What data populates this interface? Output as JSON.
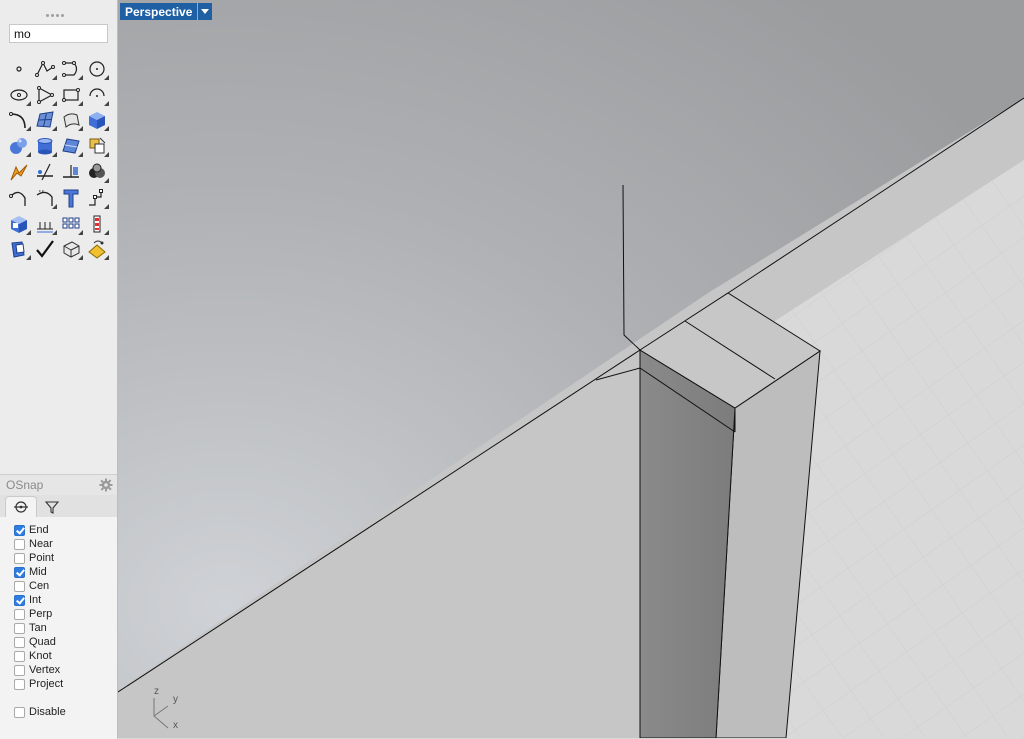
{
  "search": {
    "value": "mo"
  },
  "toolbar": {
    "tools": [
      "point-icon",
      "polyline-icon",
      "curve-icon",
      "circle-icon",
      "ellipse-icon",
      "polygon-icon",
      "rectangle-icon",
      "arc-icon",
      "fillet-curve-icon",
      "surface-patch-icon",
      "extrude-surface-icon",
      "box-icon",
      "sphere-icon",
      "cylinder-icon",
      "surface-edit-icon",
      "boolean-icon",
      "transform-icon",
      "trim-icon",
      "split-icon",
      "analyze-icon",
      "offset-curve-icon",
      "project-curve-icon",
      "text-icon",
      "point-curve-icon",
      "solid-edit-icon",
      "dimension-icon",
      "array-icon",
      "layer-icon",
      "block-icon",
      "check-icon",
      "mesh-icon",
      "render-icon"
    ]
  },
  "osnap": {
    "title": "OSnap",
    "items": [
      {
        "label": "End",
        "checked": true
      },
      {
        "label": "Near",
        "checked": false
      },
      {
        "label": "Point",
        "checked": false
      },
      {
        "label": "Mid",
        "checked": true
      },
      {
        "label": "Cen",
        "checked": false
      },
      {
        "label": "Int",
        "checked": true
      },
      {
        "label": "Perp",
        "checked": false
      },
      {
        "label": "Tan",
        "checked": false
      },
      {
        "label": "Quad",
        "checked": false
      },
      {
        "label": "Knot",
        "checked": false
      },
      {
        "label": "Vertex",
        "checked": false
      },
      {
        "label": "Project",
        "checked": false
      }
    ],
    "disable": {
      "label": "Disable",
      "checked": false
    }
  },
  "viewport": {
    "title": "Perspective",
    "axis": {
      "z": "z",
      "y": "y",
      "x": "x"
    }
  }
}
